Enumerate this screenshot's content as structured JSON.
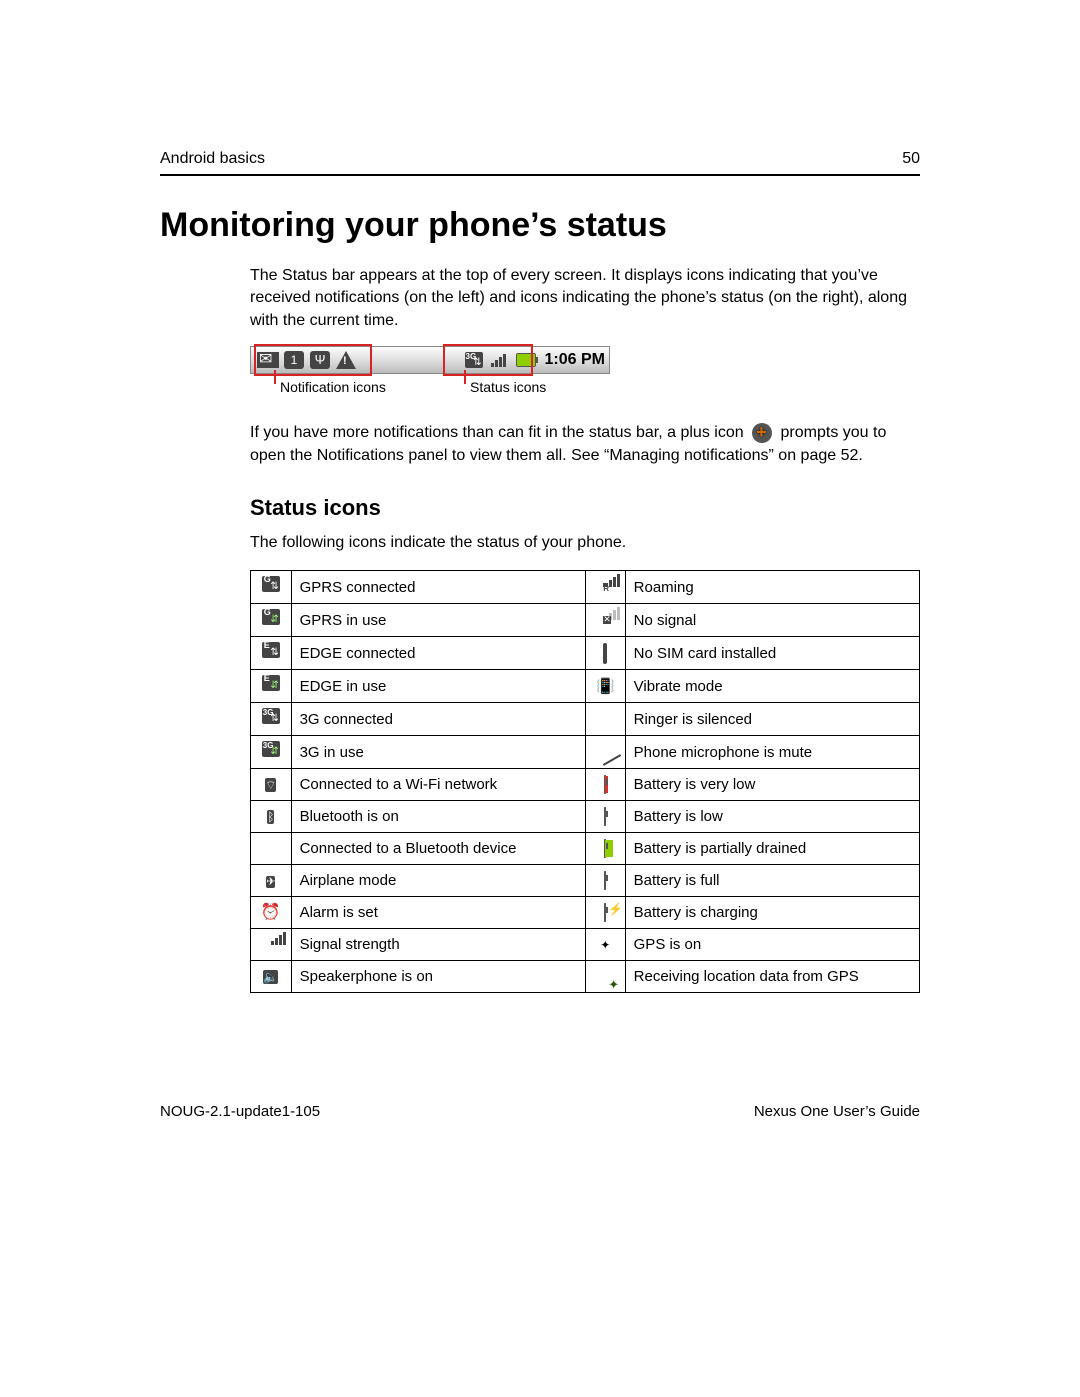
{
  "header": {
    "section": "Android basics",
    "page_number": "50"
  },
  "title": "Monitoring your phone’s status",
  "intro": "The Status bar appears at the top of every screen. It displays icons indicating that you’ve received notifications (on the left) and icons indicating the phone’s status (on the right), along with the current time.",
  "statusbar": {
    "time": "1:06 PM",
    "label_notification": "Notification icons",
    "label_status": "Status icons"
  },
  "overflow_para_a": "If you have more notifications than can fit in the status bar, a plus icon",
  "overflow_para_b": "prompts you to open the Notifications panel to view them all. See “Managing notifications” on page 52.",
  "status_heading": "Status icons",
  "status_lead": "The following icons indicate the status of your phone.",
  "rows": [
    {
      "l": "GPRS connected",
      "r": "Roaming"
    },
    {
      "l": "GPRS in use",
      "r": "No signal"
    },
    {
      "l": "EDGE connected",
      "r": "No SIM card installed"
    },
    {
      "l": "EDGE in use",
      "r": "Vibrate mode"
    },
    {
      "l": "3G connected",
      "r": "Ringer is silenced"
    },
    {
      "l": "3G in use",
      "r": "Phone microphone is mute"
    },
    {
      "l": "Connected to a Wi-Fi network",
      "r": "Battery is very low"
    },
    {
      "l": "Bluetooth is on",
      "r": "Battery is low"
    },
    {
      "l": "Connected to a Bluetooth device",
      "r": "Battery is partially drained"
    },
    {
      "l": "Airplane mode",
      "r": "Battery is full"
    },
    {
      "l": "Alarm is set",
      "r": "Battery is charging"
    },
    {
      "l": "Signal strength",
      "r": "GPS is on"
    },
    {
      "l": "Speakerphone is on",
      "r": "Receiving location data from GPS"
    }
  ],
  "footer": {
    "doc_id": "NOUG-2.1-update1-105",
    "guide": "Nexus One User’s Guide"
  }
}
